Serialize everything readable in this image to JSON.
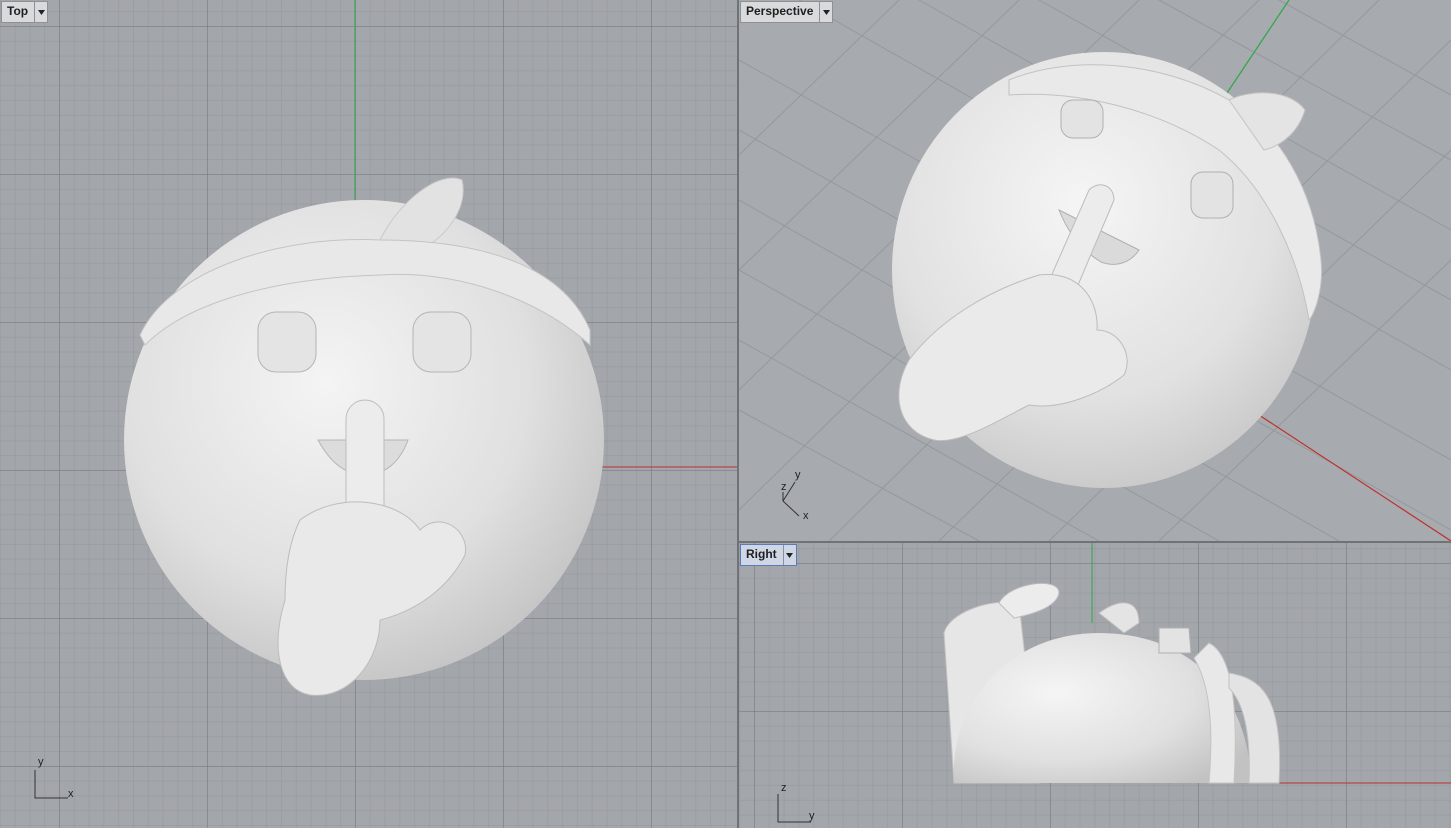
{
  "viewports": {
    "top": {
      "label": "Top",
      "axis_h": "x",
      "axis_v": "y"
    },
    "perspective": {
      "label": "Perspective",
      "axis_a": "y",
      "axis_b": "z",
      "axis_c": "x"
    },
    "right": {
      "label": "Right",
      "axis_h": "y",
      "axis_v": "z",
      "active": true
    }
  },
  "icons": {
    "dropdown": "triangle-down-icon"
  },
  "colors": {
    "x_axis": "#c0302c",
    "y_axis": "#2fa84a",
    "active_label_bg": "#cfd7e6",
    "model": "#e6e6e6"
  }
}
